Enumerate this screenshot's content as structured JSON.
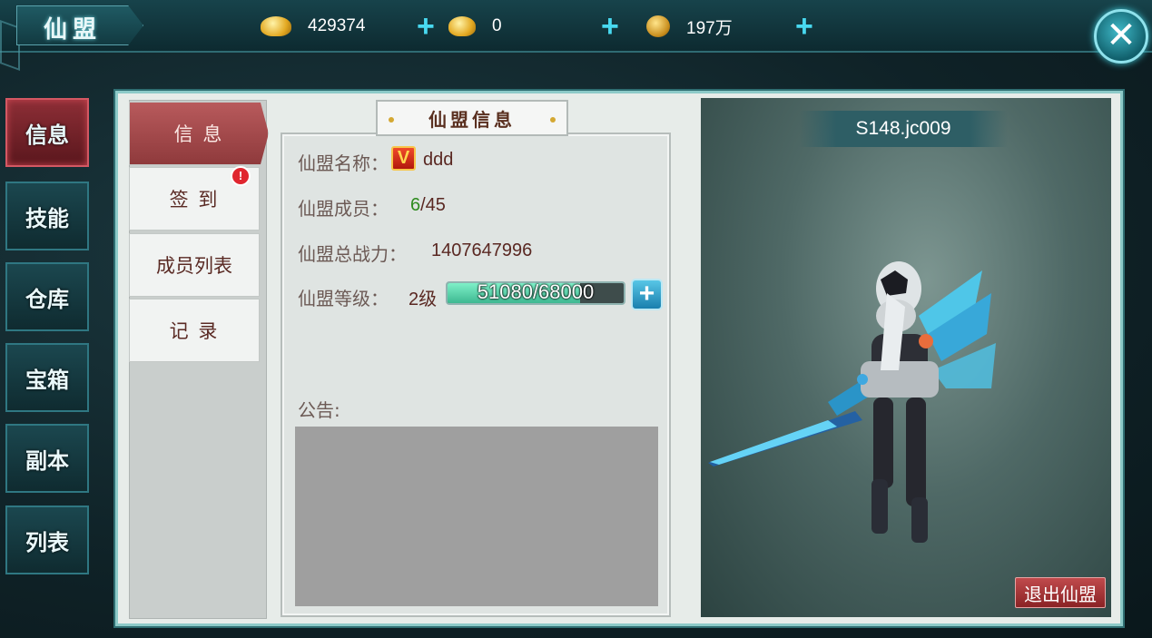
{
  "header": {
    "title": "仙盟",
    "currencies": [
      {
        "icon": "gold-ingot-icon",
        "value": "429374"
      },
      {
        "icon": "bound-ingot-icon",
        "value": "0"
      },
      {
        "icon": "coin-icon",
        "value": "197万"
      }
    ],
    "plus_label": "+",
    "close_label": "✕"
  },
  "leftnav": {
    "items": [
      "信息",
      "技能",
      "仓库",
      "宝箱",
      "副本",
      "列表"
    ],
    "active": "信息"
  },
  "subtabs": {
    "items": [
      "信 息",
      "签 到",
      "成员列表",
      "记 录"
    ],
    "active": "信 息",
    "badge": "!"
  },
  "info": {
    "heading": "仙盟信息",
    "name_label": "仙盟名称：",
    "vip_badge": "V",
    "name_value": "ddd",
    "members_label": "仙盟成员：",
    "members_current": "6",
    "members_max": "/45",
    "power_label": "仙盟总战力：",
    "power_value": "1407647996",
    "level_label": "仙盟等级：",
    "level_value": "2级",
    "exp_text": "51080/68000",
    "exp_fraction": 0.751,
    "exp_plus": "+",
    "notice_label": "公告:"
  },
  "character": {
    "name": "S148.jc009",
    "quit_label": "退出仙盟"
  },
  "colors": {
    "accent": "#48d9f0",
    "active_tab": "#8f3a3c",
    "exp_fill": "#3eb891"
  }
}
